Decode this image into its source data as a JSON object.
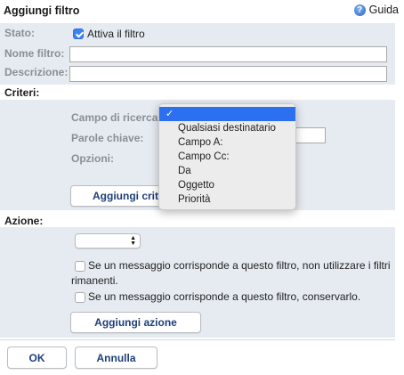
{
  "header": {
    "title": "Aggiungi filtro",
    "help_label": "Guida",
    "help_icon": "question-circle-icon"
  },
  "form": {
    "stato_label": "Stato:",
    "attiva_label": "Attiva il filtro",
    "attiva_checked": true,
    "nome_label": "Nome filtro:",
    "nome_value": "",
    "descrizione_label": "Descrizione:",
    "descrizione_value": ""
  },
  "criteri": {
    "section_label": "Criteri:",
    "campo_label": "Campo di ricerca:",
    "parole_label": "Parole chiave:",
    "parole_value": "",
    "opzioni_label": "Opzioni:",
    "add_button": "Aggiungi criterio",
    "dropdown": {
      "selected_index": 0,
      "items": [
        "",
        "Qualsiasi destinatario",
        "Campo A:",
        "Campo Cc:",
        "Da",
        "Oggetto",
        "Priorità"
      ]
    }
  },
  "azione": {
    "section_label": "Azione:",
    "select_value": "",
    "opt1_label": "Se un messaggio corrisponde a questo filtro, non utilizzare i filtri rimanenti.",
    "opt1_checked": false,
    "opt2_label": "Se un messaggio corrisponde a questo filtro, conservarlo.",
    "opt2_checked": false,
    "add_button": "Aggiungi azione"
  },
  "footer": {
    "ok_label": "OK",
    "cancel_label": "Annulla"
  },
  "colors": {
    "band": "#e6ebf1",
    "accent": "#2c6ff0",
    "button_text": "#1e3f7a"
  }
}
